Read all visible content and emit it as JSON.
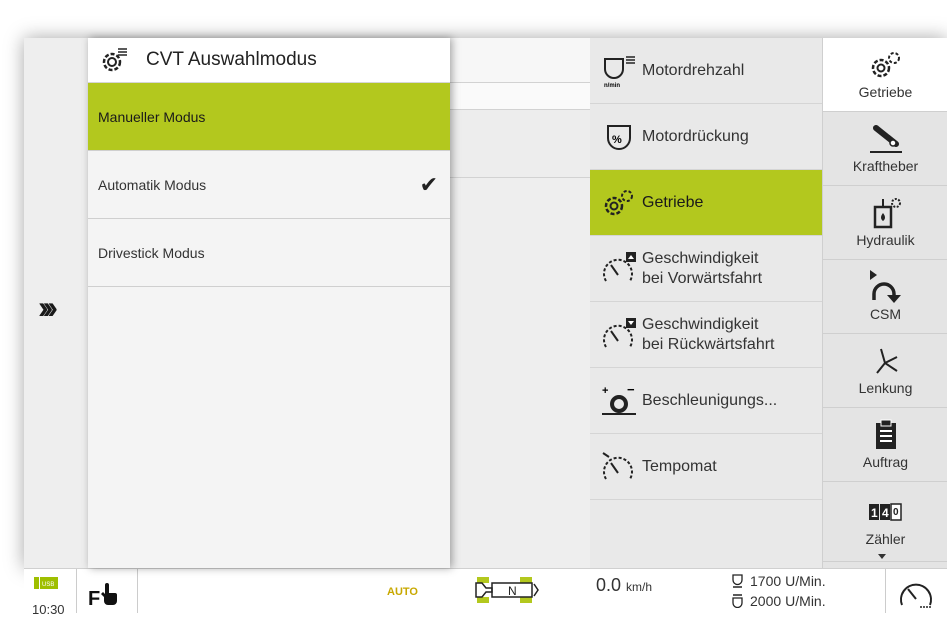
{
  "cvt_panel": {
    "title": "CVT Auswahlmodus",
    "options": [
      {
        "label": "Manueller Modus",
        "selected": true
      },
      {
        "label": "Automatik Modus",
        "checked": true
      },
      {
        "label": "Drivestick Modus"
      }
    ]
  },
  "settings_list": [
    {
      "label": "Motordrehzahl",
      "icon": "engine-speed-icon"
    },
    {
      "label": "Motordrückung",
      "icon": "engine-droop-icon"
    },
    {
      "label": "Getriebe",
      "icon": "gear-icon",
      "selected": true
    },
    {
      "label_line1": "Geschwindigkeit",
      "label_line2": "bei Vorwärtsfahrt",
      "icon": "forward-speed-icon"
    },
    {
      "label_line1": "Geschwindigkeit",
      "label_line2": "bei Rückwärtsfahrt",
      "icon": "reverse-speed-icon"
    },
    {
      "label": "Beschleunigungs...",
      "icon": "acceleration-icon"
    },
    {
      "label": "Tempomat",
      "icon": "cruise-control-icon"
    }
  ],
  "tabs": [
    {
      "label": "Getriebe",
      "icon": "gear-icon",
      "active": true
    },
    {
      "label": "Kraftheber",
      "icon": "hitch-icon"
    },
    {
      "label": "Hydraulik",
      "icon": "hydraulic-icon"
    },
    {
      "label": "CSM",
      "icon": "csm-icon"
    },
    {
      "label": "Lenkung",
      "icon": "steering-icon"
    },
    {
      "label": "Auftrag",
      "icon": "clipboard-icon"
    },
    {
      "label": "Zähler",
      "icon": "counter-icon"
    }
  ],
  "status_bar": {
    "time": "10:30",
    "usb_label": "USB",
    "f_label": "F",
    "auto_label": "AUTO",
    "gear": "N",
    "speed_value": "0.0",
    "speed_unit": "km/h",
    "rpm1": "1700",
    "rpm2": "2000",
    "rpm_unit": "U/Min."
  },
  "colors": {
    "accent": "#b3c81e",
    "auto_label": "#c8a800"
  }
}
